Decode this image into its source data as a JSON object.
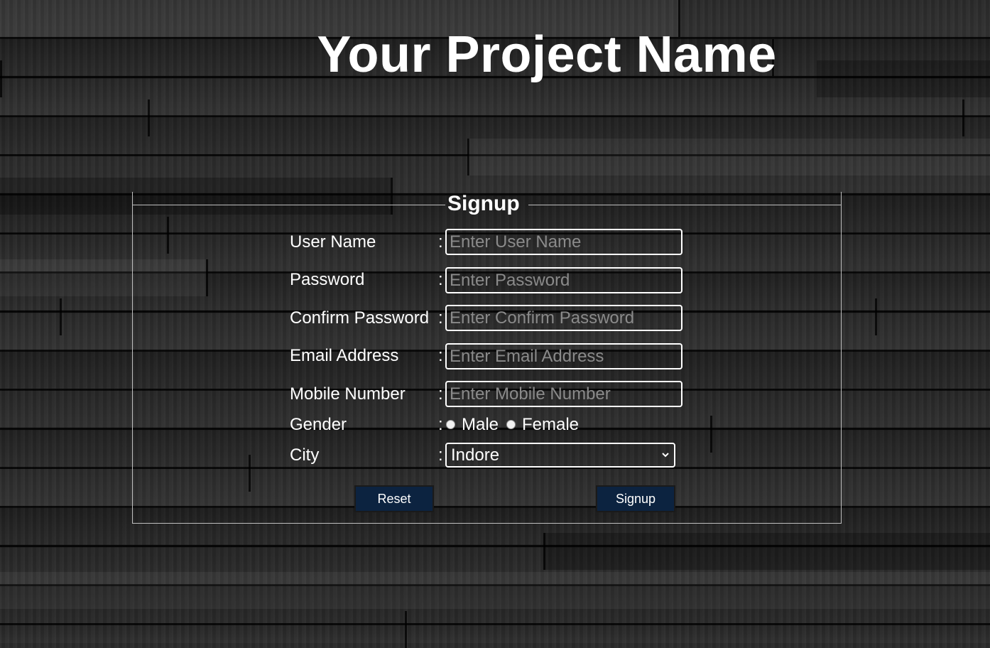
{
  "page": {
    "title": "Your Project Name"
  },
  "form": {
    "legend": "Signup",
    "fields": [
      {
        "label": "User Name",
        "separator": ":",
        "placeholder": "Enter User Name",
        "value": ""
      },
      {
        "label": "Password",
        "separator": ":",
        "placeholder": "Enter Password",
        "value": ""
      },
      {
        "label": "Confirm Password",
        "separator": ":",
        "placeholder": "Enter Confirm Password",
        "value": ""
      },
      {
        "label": "Email Address",
        "separator": ":",
        "placeholder": "Enter Email Address",
        "value": ""
      },
      {
        "label": "Mobile Number",
        "separator": ":",
        "placeholder": "Enter Mobile Number",
        "value": ""
      }
    ],
    "gender": {
      "label": "Gender",
      "separator": ":",
      "options": [
        "Male",
        "Female"
      ]
    },
    "city": {
      "label": "City",
      "separator": ":",
      "selected": "Indore"
    },
    "buttons": {
      "reset_label": "Reset",
      "signup_label": "Signup"
    }
  },
  "colors": {
    "button_bg": "#0c2340",
    "text": "#ffffff",
    "placeholder": "#8a8a8a",
    "border": "#bfbfbf"
  },
  "icons": {
    "select_chevron": "chevron-down-icon"
  }
}
